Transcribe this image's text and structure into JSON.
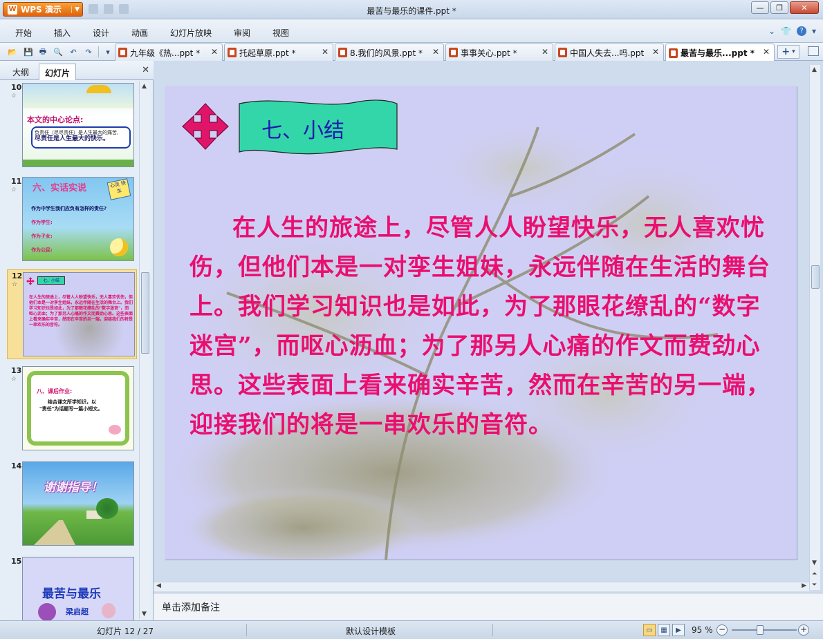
{
  "app": {
    "name": "WPS 演示",
    "window_title": "最苦与最乐的课件.ppt *"
  },
  "menu": [
    "开始",
    "插入",
    "设计",
    "动画",
    "幻灯片放映",
    "审阅",
    "视图"
  ],
  "doc_tabs": [
    {
      "label": "九年级《热...ppt *",
      "active": false
    },
    {
      "label": "托起草原.ppt *",
      "active": false
    },
    {
      "label": "8.我们的风景.ppt *",
      "active": false
    },
    {
      "label": "事事关心.ppt *",
      "active": false
    },
    {
      "label": "中国人失去...吗.ppt",
      "active": false
    },
    {
      "label": "最苦与最乐...ppt *",
      "active": true
    }
  ],
  "left_panel": {
    "tabs": [
      "大纲",
      "幻灯片"
    ],
    "active_tab": "幻灯片",
    "slides": [
      {
        "num": "10",
        "heading": "本文的中心论点:",
        "line1": "负责任（尽尽责任）是人生最大的痛苦,",
        "line2": "尽责任是人生最大的快乐。"
      },
      {
        "num": "11",
        "title": "六、实话实说",
        "badge": "心灵 快车",
        "q": "作为中学生我们应负有怎样的责任?",
        "a1": "作为学生:",
        "a2": "作为子女:",
        "a3": "作为公民:"
      },
      {
        "num": "12",
        "banner": "七、小结",
        "text": "在人生的旅途上，尽管人人盼望快乐，无人喜欢忧伤，但他们本是一对孪生姐妹，永远伴随在生活的舞台上。我们学习知识也是如此，为了那眼花缭乱的\"数字迷宫\"，而呕心沥血；为了那另人心痛的作文而费劲心思。这些表面上看来确实辛苦，然而在辛苦的另一端，迎接我们的将是一串欢乐的音符。"
      },
      {
        "num": "13",
        "heading": "八、课后作业:",
        "body1": "结合课文所学知识，以",
        "body2": "\"责任\"为话题写一篇小短文。"
      },
      {
        "num": "14",
        "title": "谢谢指导！"
      },
      {
        "num": "15",
        "title": "最苦与最乐",
        "author": "梁启超"
      }
    ]
  },
  "slide": {
    "heading": "七、小结",
    "body": "在人生的旅途上，尽管人人盼望快乐，无人喜欢忧伤，但他们本是一对孪生姐妹，永远伴随在生活的舞台上。我们学习知识也是如此，为了那眼花缭乱的“数字迷宫”，而呕心沥血；为了那另人心痛的作文而费劲心思。这些表面上看来确实辛苦，然而在辛苦的另一端，迎接我们的将是一串欢乐的音符。",
    "colors": {
      "background": "#cfcff5",
      "body_text": "#ea0f6f",
      "heading_text": "#1a1ab0",
      "banner": "#33d6a8",
      "arrow": "#e0156a"
    }
  },
  "notes_placeholder": "单击添加备注",
  "status": {
    "slide_counter": "幻灯片 12 / 27",
    "template": "默认设计模板",
    "zoom": "95 %"
  }
}
